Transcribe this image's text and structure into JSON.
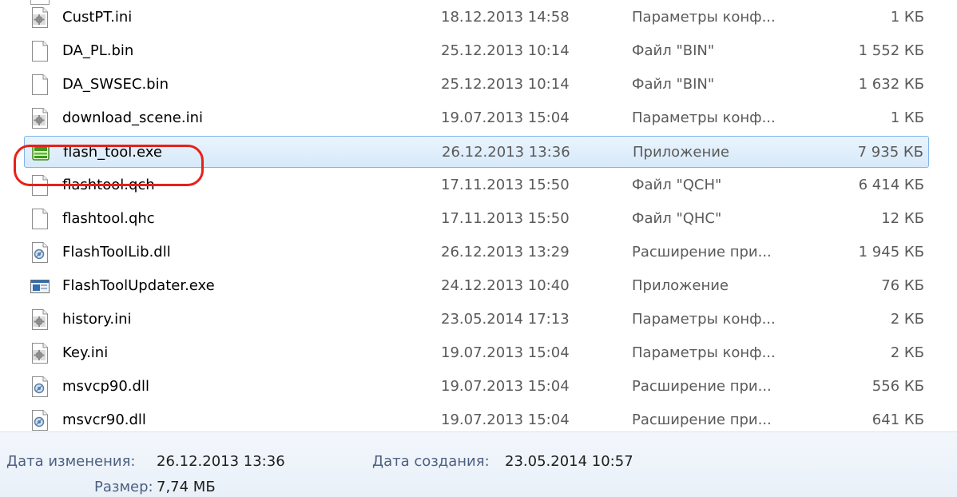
{
  "files": [
    {
      "name": "CustPT.ini",
      "date": "18.12.2013 14:58",
      "type": "Параметры конф...",
      "size": "1 КБ",
      "icon": "ini-settings-icon"
    },
    {
      "name": "DA_PL.bin",
      "date": "25.12.2013 10:14",
      "type": "Файл \"BIN\"",
      "size": "1 552 КБ",
      "icon": "blank-file-icon"
    },
    {
      "name": "DA_SWSEC.bin",
      "date": "25.12.2013 10:14",
      "type": "Файл \"BIN\"",
      "size": "1 632 КБ",
      "icon": "blank-file-icon"
    },
    {
      "name": "download_scene.ini",
      "date": "19.07.2013 15:04",
      "type": "Параметры конф...",
      "size": "1 КБ",
      "icon": "ini-settings-icon"
    },
    {
      "name": "flash_tool.exe",
      "date": "26.12.2013 13:36",
      "type": "Приложение",
      "size": "7 935 КБ",
      "icon": "flash-tool-app-icon",
      "selected": true
    },
    {
      "name": "flashtool.qch",
      "date": "17.11.2013 15:50",
      "type": "Файл \"QCH\"",
      "size": "6 414 КБ",
      "icon": "blank-file-icon"
    },
    {
      "name": "flashtool.qhc",
      "date": "17.11.2013 15:50",
      "type": "Файл \"QHC\"",
      "size": "12 КБ",
      "icon": "blank-file-icon"
    },
    {
      "name": "FlashToolLib.dll",
      "date": "26.12.2013 13:29",
      "type": "Расширение при...",
      "size": "1 945 КБ",
      "icon": "dll-gear-icon"
    },
    {
      "name": "FlashToolUpdater.exe",
      "date": "24.12.2013 10:40",
      "type": "Приложение",
      "size": "76 КБ",
      "icon": "exe-window-icon"
    },
    {
      "name": "history.ini",
      "date": "23.05.2014 17:13",
      "type": "Параметры конф...",
      "size": "2 КБ",
      "icon": "ini-settings-icon"
    },
    {
      "name": "Key.ini",
      "date": "19.07.2013 15:04",
      "type": "Параметры конф...",
      "size": "2 КБ",
      "icon": "ini-settings-icon"
    },
    {
      "name": "msvcp90.dll",
      "date": "19.07.2013 15:04",
      "type": "Расширение при...",
      "size": "556 КБ",
      "icon": "dll-gear-icon"
    },
    {
      "name": "msvcr90.dll",
      "date": "19.07.2013 15:04",
      "type": "Расширение при...",
      "size": "641 КБ",
      "icon": "dll-gear-icon"
    }
  ],
  "details": {
    "modified_label": "Дата изменения:",
    "modified_value": "26.12.2013 13:36",
    "created_label": "Дата создания:",
    "created_value": "23.05.2014 10:57",
    "size_label": "Размер:",
    "size_value": "7,74 МБ"
  },
  "colors": {
    "highlight_ring": "#e8201a",
    "selection_border": "#7eb4ea",
    "details_label": "#4d6082"
  }
}
